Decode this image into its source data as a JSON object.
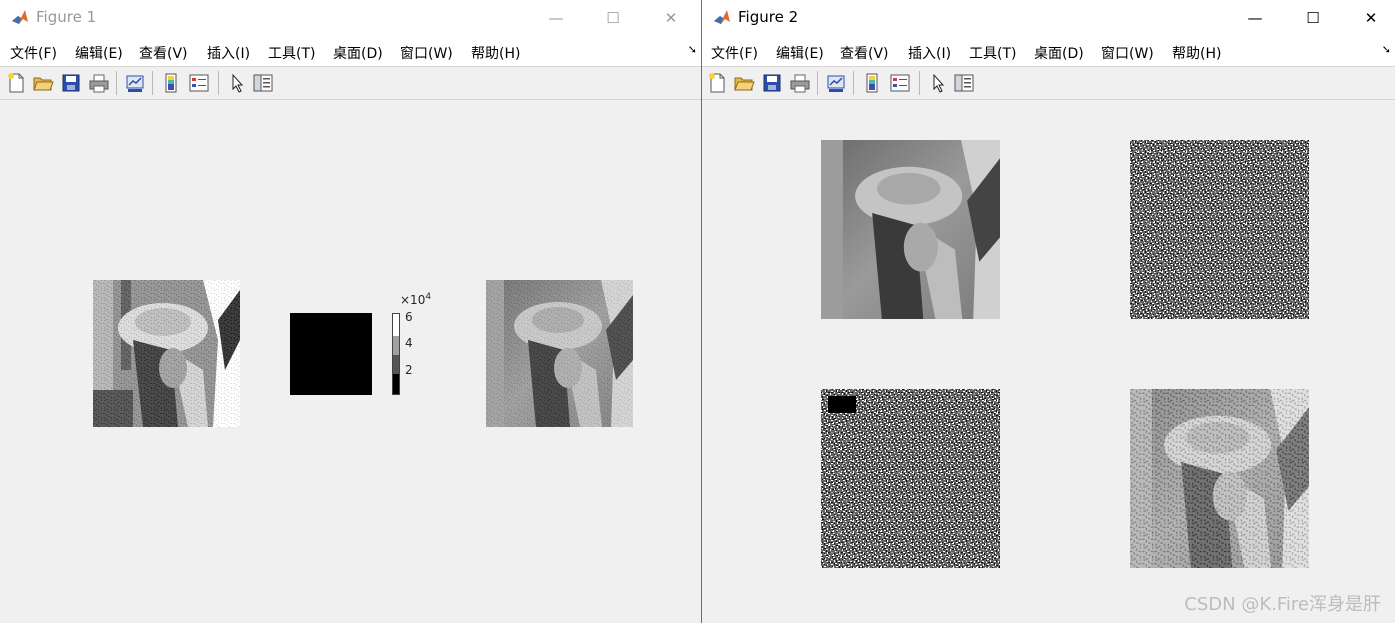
{
  "windows": [
    {
      "title": "Figure 1",
      "menu": [
        "文件(F)",
        "编辑(E)",
        "查看(V)",
        "插入(I)",
        "工具(T)",
        "桌面(D)",
        "窗口(W)",
        "帮助(H)"
      ],
      "colorbar": {
        "exponent_base": "×10",
        "exponent": "4",
        "ticks": [
          "6",
          "4",
          "2"
        ]
      }
    },
    {
      "title": "Figure 2",
      "menu": [
        "文件(F)",
        "编辑(E)",
        "查看(V)",
        "插入(I)",
        "工具(T)",
        "桌面(D)",
        "窗口(W)",
        "帮助(H)"
      ]
    }
  ],
  "window_controls": {
    "minimize": "—",
    "maximize": "☐",
    "close": "✕"
  },
  "watermark": "CSDN @K.Fire浑身是肝",
  "colors": {
    "accent": "#e06a2c",
    "window_border": "#6e6e6e"
  },
  "icons": [
    "matlab-logo-icon",
    "new-figure-icon",
    "open-file-icon",
    "save-icon",
    "print-icon",
    "link-plot-icon",
    "insert-colorbar-icon",
    "insert-legend-icon",
    "pointer-icon",
    "property-inspector-icon"
  ]
}
